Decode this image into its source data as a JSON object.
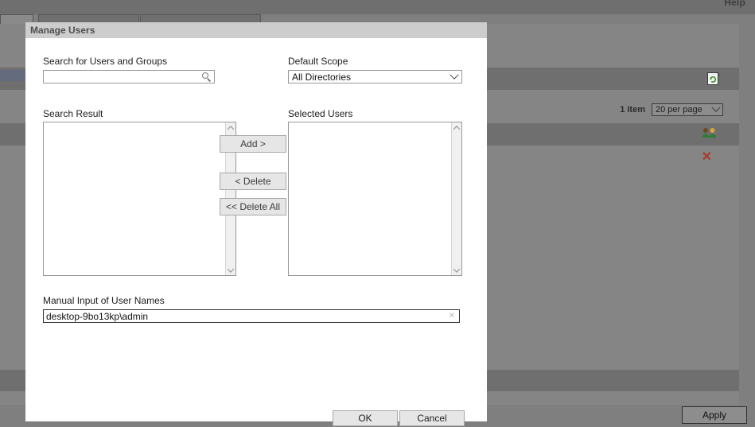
{
  "background": {
    "help_label": "Help",
    "item_count": "1 item",
    "per_page": "20 per page",
    "apply_label": "Apply",
    "icons": {
      "refresh_document": "refresh-document-icon",
      "users": "users-icon",
      "delete": "red-x-delete-icon"
    }
  },
  "dialog": {
    "title": "Manage Users",
    "search": {
      "label": "Search for Users and Groups",
      "value": "",
      "placeholder": "",
      "icon": "search-icon"
    },
    "scope": {
      "label": "Default Scope",
      "selected": "All Directories",
      "options": [
        "All Directories"
      ]
    },
    "search_result": {
      "label": "Search Result",
      "items": []
    },
    "selected_users": {
      "label": "Selected Users",
      "items": []
    },
    "transfer_buttons": {
      "add": "Add >",
      "delete": "< Delete",
      "delete_all": "<< Delete All"
    },
    "manual_input": {
      "label": "Manual Input of User Names",
      "value": "desktop-9bo13kp\\admin",
      "clear_icon": "clear-x-icon"
    },
    "footer": {
      "ok": "OK",
      "cancel": "Cancel"
    }
  },
  "colors": {
    "page_bg": "#7f7f7f",
    "panel_bg": "#858585",
    "band_dark": "#6f6f6f",
    "dialog_title_bg": "#cdcdcd",
    "dialog_bg": "#ffffff",
    "selected_row": "#636b7c",
    "delete_red": "#a83a2a"
  }
}
